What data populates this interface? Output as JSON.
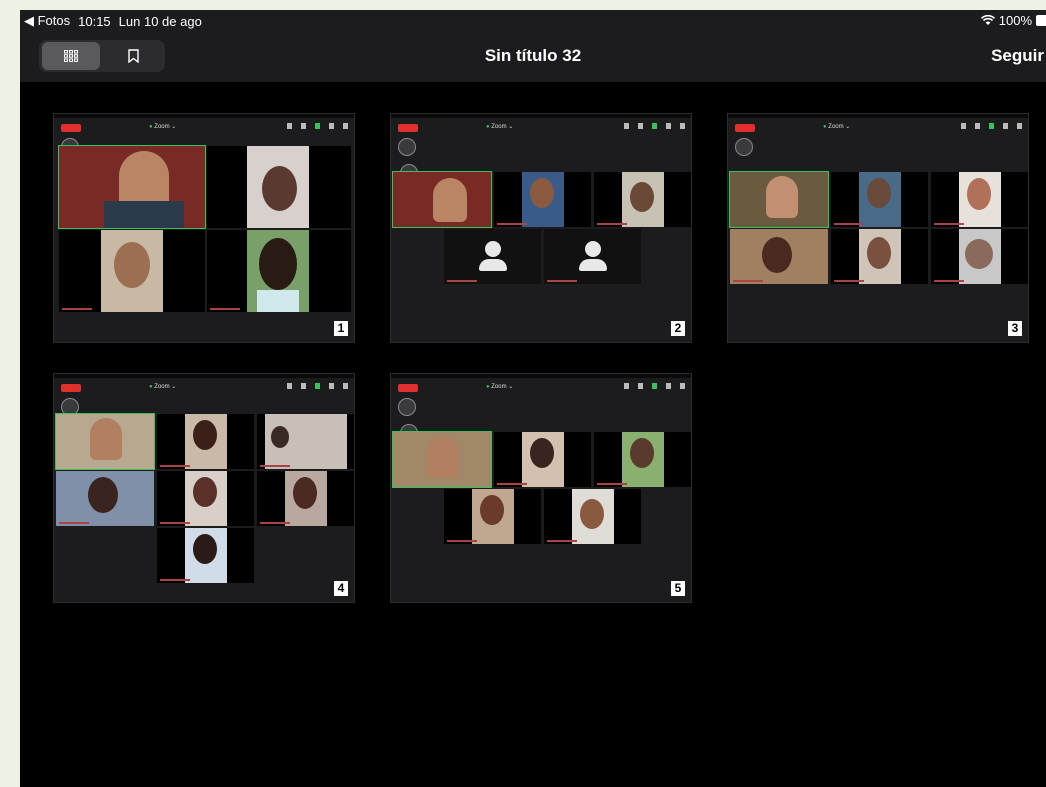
{
  "status_bar": {
    "back_label": "◀ Fotos",
    "time": "10:15",
    "date": "Lun 10 de ago",
    "battery": "100%"
  },
  "nav": {
    "title": "Sin título 32",
    "action": "Seguir"
  },
  "pages": [
    {
      "number": "1"
    },
    {
      "number": "2"
    },
    {
      "number": "3"
    },
    {
      "number": "4"
    },
    {
      "number": "5"
    }
  ],
  "zoom_label": "Zoom ⌄",
  "fin_label": "Fin",
  "colors": {
    "background": "#000000",
    "bar": "#1c1c1e",
    "accent_green": "#37c35a",
    "end_red": "#e0302e"
  }
}
